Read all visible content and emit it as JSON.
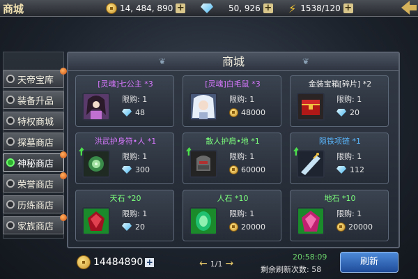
{
  "topbar": {
    "title": "商城",
    "gold": "14, 484, 890",
    "diamonds": "50, 926",
    "stamina": "1538/120"
  },
  "sidebar": {
    "items": [
      {
        "label": "天帝宝库",
        "active": false,
        "dot": true
      },
      {
        "label": "装备升品",
        "active": false,
        "dot": false
      },
      {
        "label": "特权商城",
        "active": false,
        "dot": false
      },
      {
        "label": "探墓商店",
        "active": false,
        "dot": false
      },
      {
        "label": "神秘商店",
        "active": true,
        "dot": true
      },
      {
        "label": "荣誉商店",
        "active": false,
        "dot": true
      },
      {
        "label": "历练商店",
        "active": false,
        "dot": false
      },
      {
        "label": "家族商店",
        "active": false,
        "dot": true
      }
    ]
  },
  "panel": {
    "title": "商城",
    "items": [
      {
        "name": "[灵魂]七公主 *3",
        "name_color": "#d878ff",
        "limit": "限购: 1",
        "currency": "diamond",
        "price": "48",
        "icon": "female-hero-portrait-icon"
      },
      {
        "name": "[灵魂]白毛鼠 *3",
        "name_color": "#d878ff",
        "limit": "限购: 1",
        "currency": "gold",
        "price": "48000",
        "icon": "white-hair-hero-portrait-icon"
      },
      {
        "name": "金装宝箱[碎片] *2",
        "name_color": "#f0f0f0",
        "limit": "限购: 1",
        "currency": "diamond",
        "price": "20",
        "icon": "red-treasure-chest-icon"
      },
      {
        "name": "洪武护身符•人 *1",
        "name_color": "#d878ff",
        "limit": "限购: 1",
        "currency": "diamond",
        "price": "300",
        "icon": "green-amulet-icon",
        "upgrade": true
      },
      {
        "name": "散人护肩•地 *1",
        "name_color": "#7cff7c",
        "limit": "限购: 1",
        "currency": "gold",
        "price": "60000",
        "icon": "shoulder-armor-icon",
        "upgrade": true
      },
      {
        "name": "陨铁项链 *1",
        "name_color": "#5ab8ff",
        "limit": "限购: 1",
        "currency": "diamond",
        "price": "112",
        "icon": "crystal-necklace-icon",
        "upgrade": true
      },
      {
        "name": "天石 *20",
        "name_color": "#7cff7c",
        "limit": "限购: 1",
        "currency": "diamond",
        "price": "20",
        "icon": "red-heaven-stone-icon"
      },
      {
        "name": "人石 *10",
        "name_color": "#7cff7c",
        "limit": "限购: 1",
        "currency": "gold",
        "price": "20000",
        "icon": "green-human-stone-icon"
      },
      {
        "name": "地石 *10",
        "name_color": "#7cff7c",
        "limit": "限购: 1",
        "currency": "gold",
        "price": "20000",
        "icon": "pink-earth-stone-icon"
      }
    ]
  },
  "bottom": {
    "gold_total": "14484890",
    "page": "1/1",
    "timer": "20:58:09",
    "refresh_count_label": "剩余刷新次数:",
    "refresh_count": "58",
    "refresh_button": "刷新"
  }
}
